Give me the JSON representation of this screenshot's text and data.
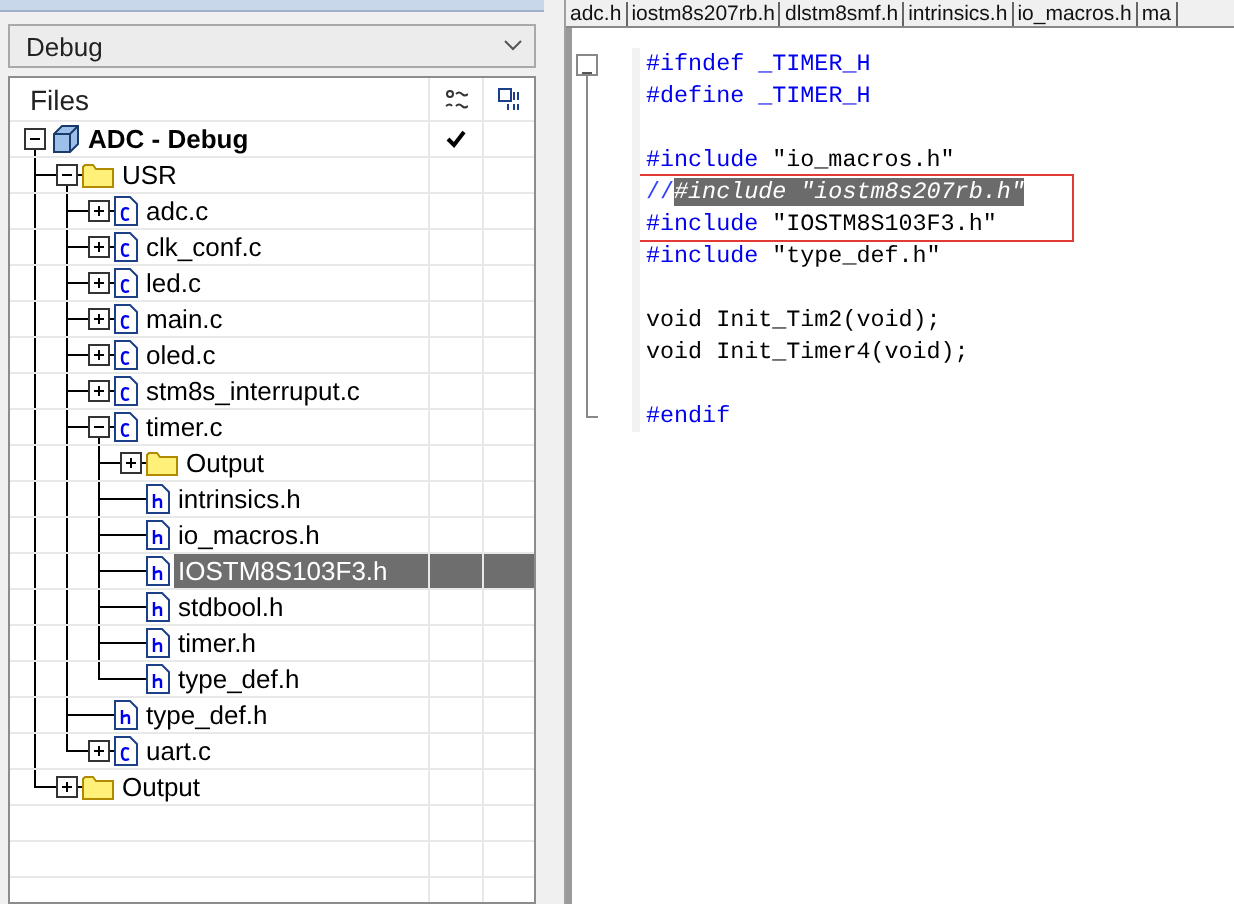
{
  "workspace": {
    "config": "Debug",
    "files_header": "Files"
  },
  "tree": [
    {
      "label": "ADC - Debug",
      "kind": "project",
      "expanded": true,
      "checked": true,
      "selected": false,
      "children": [
        {
          "label": "USR",
          "kind": "folder",
          "expanded": true,
          "checked": false,
          "selected": false,
          "children": [
            {
              "label": "adc.c",
              "kind": "c",
              "expanded": false,
              "checked": false,
              "selected": false
            },
            {
              "label": "clk_conf.c",
              "kind": "c",
              "expanded": false,
              "checked": false,
              "selected": false
            },
            {
              "label": "led.c",
              "kind": "c",
              "expanded": false,
              "checked": false,
              "selected": false
            },
            {
              "label": "main.c",
              "kind": "c",
              "expanded": false,
              "checked": false,
              "selected": false
            },
            {
              "label": "oled.c",
              "kind": "c",
              "expanded": false,
              "checked": false,
              "selected": false
            },
            {
              "label": "stm8s_interruput.c",
              "kind": "c",
              "expanded": false,
              "checked": false,
              "selected": false
            },
            {
              "label": "timer.c",
              "kind": "c",
              "expanded": true,
              "checked": false,
              "selected": false,
              "children": [
                {
                  "label": "Output",
                  "kind": "folder",
                  "expanded": false,
                  "checked": false,
                  "selected": false
                },
                {
                  "label": "intrinsics.h",
                  "kind": "h",
                  "checked": false,
                  "selected": false
                },
                {
                  "label": "io_macros.h",
                  "kind": "h",
                  "checked": false,
                  "selected": false
                },
                {
                  "label": "IOSTM8S103F3.h",
                  "kind": "h",
                  "checked": false,
                  "selected": true
                },
                {
                  "label": "stdbool.h",
                  "kind": "h",
                  "checked": false,
                  "selected": false
                },
                {
                  "label": "timer.h",
                  "kind": "h",
                  "checked": false,
                  "selected": false
                },
                {
                  "label": "type_def.h",
                  "kind": "h",
                  "checked": false,
                  "selected": false
                }
              ]
            },
            {
              "label": "type_def.h",
              "kind": "h",
              "checked": false,
              "selected": false
            },
            {
              "label": "uart.c",
              "kind": "c",
              "expanded": false,
              "checked": false,
              "selected": false
            }
          ]
        },
        {
          "label": "Output",
          "kind": "folder",
          "expanded": false,
          "checked": false,
          "selected": false
        }
      ]
    }
  ],
  "editor_tabs": [
    {
      "label": "adc.h",
      "selected": false
    },
    {
      "label": "iostm8s207rb.h",
      "selected": false
    },
    {
      "label": "dlstm8smf.h",
      "selected": false
    },
    {
      "label": "intrinsics.h",
      "selected": false
    },
    {
      "label": "io_macros.h",
      "selected": false
    },
    {
      "label": "ma",
      "selected": false
    }
  ],
  "code_lines": [
    {
      "kind": "code",
      "boxed": false,
      "segments": [
        {
          "text": "#ifndef",
          "kind": "directive"
        },
        {
          "text": " _TIMER_H",
          "kind": "directive"
        }
      ]
    },
    {
      "kind": "code",
      "boxed": false,
      "segments": [
        {
          "text": "#define",
          "kind": "directive"
        },
        {
          "text": " _TIMER_H",
          "kind": "directive"
        }
      ]
    },
    {
      "kind": "blank"
    },
    {
      "kind": "code",
      "boxed": false,
      "segments": [
        {
          "text": "#include",
          "kind": "directive"
        },
        {
          "text": " \"io_macros.h\"",
          "kind": "plain"
        }
      ]
    },
    {
      "kind": "code",
      "boxed": true,
      "segments": [
        {
          "text": "//",
          "kind": "comment"
        },
        {
          "text": "#include \"iostm8s207rb.h\"",
          "kind": "selection"
        }
      ]
    },
    {
      "kind": "code",
      "boxed": true,
      "segments": [
        {
          "text": "#include",
          "kind": "directive"
        },
        {
          "text": " \"IOSTM8S103F3.h\"",
          "kind": "plain"
        }
      ]
    },
    {
      "kind": "code",
      "boxed": false,
      "segments": [
        {
          "text": "#include",
          "kind": "directive"
        },
        {
          "text": " \"type_def.h\"",
          "kind": "plain"
        }
      ]
    },
    {
      "kind": "blank"
    },
    {
      "kind": "code",
      "boxed": false,
      "segments": [
        {
          "text": "void Init_Tim2(void);",
          "kind": "plain"
        }
      ]
    },
    {
      "kind": "code",
      "boxed": false,
      "segments": [
        {
          "text": "void Init_Timer4(void);",
          "kind": "plain"
        }
      ]
    },
    {
      "kind": "blank"
    },
    {
      "kind": "code",
      "boxed": false,
      "segments": [
        {
          "text": "#endif",
          "kind": "directive"
        }
      ]
    }
  ]
}
